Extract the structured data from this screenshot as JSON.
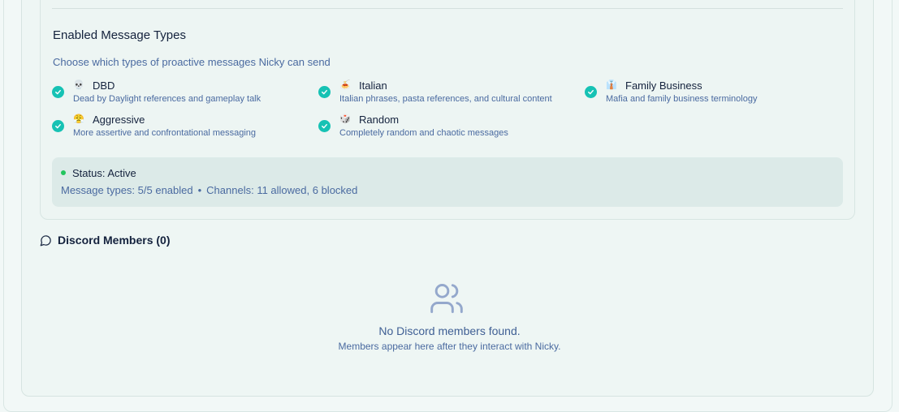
{
  "message_types_section": {
    "title": "Enabled Message Types",
    "subtitle": "Choose which types of proactive messages Nicky can send",
    "types": [
      {
        "emoji": "💀",
        "name": "DBD",
        "description": "Dead by Daylight references and gameplay talk",
        "enabled": true
      },
      {
        "emoji": "🍝",
        "name": "Italian",
        "description": "Italian phrases, pasta references, and cultural content",
        "enabled": true
      },
      {
        "emoji": "👔",
        "name": "Family Business",
        "description": "Mafia and family business terminology",
        "enabled": true
      },
      {
        "emoji": "😤",
        "name": "Aggressive",
        "description": "More assertive and confrontational messaging",
        "enabled": true
      },
      {
        "emoji": "🎲",
        "name": "Random",
        "description": "Completely random and chaotic messages",
        "enabled": true
      }
    ]
  },
  "status": {
    "label": "Status: Active",
    "message_types": "Message types: 5/5 enabled",
    "bullet": "•",
    "channels": "Channels: 11 allowed, 6 blocked"
  },
  "discord_members": {
    "title": "Discord Members (0)",
    "empty_title": "No Discord members found.",
    "empty_subtitle": "Members appear here after they interact with Nicky."
  },
  "colors": {
    "accent": "#16c2b4",
    "status_active": "#22c55e",
    "muted_text": "#4a6aa0"
  }
}
